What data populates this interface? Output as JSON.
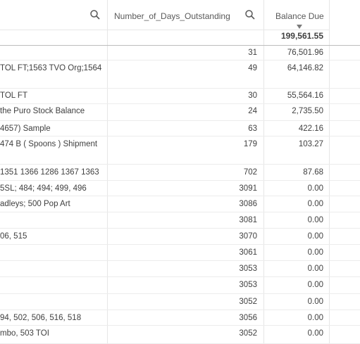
{
  "columns": {
    "days_header": "Number_of_Days_Outstanding",
    "balance_header": "Balance Due",
    "balance_total": "199,561.55"
  },
  "rows": [
    {
      "desc": "",
      "days": "31",
      "balance": "76,501.96"
    },
    {
      "desc": "TOL FT;1563 TVO Org;1564",
      "days": "49",
      "balance": "64,146.82"
    },
    {
      "desc": "TOL FT",
      "days": "30",
      "balance": "55,564.16"
    },
    {
      "desc": "the Puro Stock Balance",
      "days": "24",
      "balance": "2,735.50"
    },
    {
      "desc": "4657) Sample",
      "days": "63",
      "balance": "422.16"
    },
    {
      "desc": "474 B ( Spoons ) Shipment",
      "days": "179",
      "balance": "103.27"
    },
    {
      "desc": "1351 1366 1286 1367 1363",
      "days": "702",
      "balance": "87.68"
    },
    {
      "desc": "5SL; 484; 494; 499, 496",
      "days": "3091",
      "balance": "0.00"
    },
    {
      "desc": "adleys; 500 Pop Art",
      "days": "3086",
      "balance": "0.00"
    },
    {
      "desc": "",
      "days": "3081",
      "balance": "0.00"
    },
    {
      "desc": "06, 515",
      "days": "3070",
      "balance": "0.00"
    },
    {
      "desc": "",
      "days": "3061",
      "balance": "0.00"
    },
    {
      "desc": "",
      "days": "3053",
      "balance": "0.00"
    },
    {
      "desc": "",
      "days": "3053",
      "balance": "0.00"
    },
    {
      "desc": "",
      "days": "3052",
      "balance": "0.00"
    },
    {
      "desc": "94, 502, 506, 516, 518",
      "days": "3056",
      "balance": "0.00"
    },
    {
      "desc": "mbo, 503 TOI",
      "days": "3052",
      "balance": "0.00"
    }
  ]
}
